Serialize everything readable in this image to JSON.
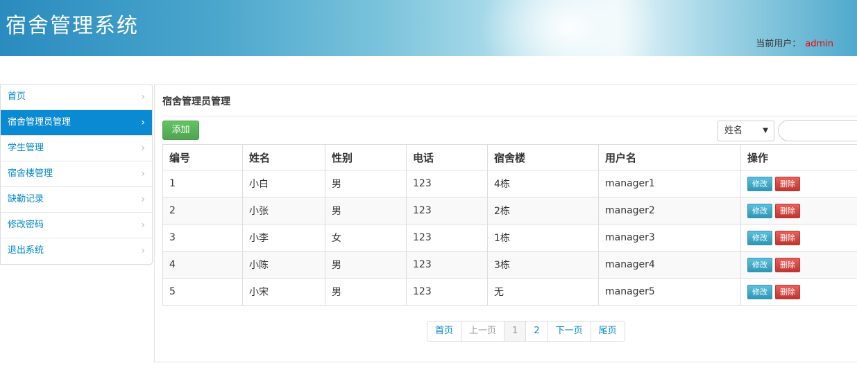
{
  "header": {
    "title": "宿舍管理系统",
    "user_label": "当前用户：",
    "user_name": "admin"
  },
  "sidebar": {
    "items": [
      {
        "label": "首页",
        "active": false
      },
      {
        "label": "宿舍管理员管理",
        "active": true
      },
      {
        "label": "学生管理",
        "active": false
      },
      {
        "label": "宿舍楼管理",
        "active": false
      },
      {
        "label": "缺勤记录",
        "active": false
      },
      {
        "label": "修改密码",
        "active": false
      },
      {
        "label": "退出系统",
        "active": false
      }
    ],
    "chevron": "›"
  },
  "main": {
    "title": "宿舍管理员管理",
    "add_label": "添加",
    "search": {
      "field_selected": "姓名",
      "input_value": ""
    },
    "table": {
      "headers": [
        "编号",
        "姓名",
        "性别",
        "电话",
        "宿舍楼",
        "用户名",
        "操作"
      ],
      "rows": [
        [
          "1",
          "小白",
          "男",
          "123",
          "4栋",
          "manager1"
        ],
        [
          "2",
          "小张",
          "男",
          "123",
          "2栋",
          "manager2"
        ],
        [
          "3",
          "小李",
          "女",
          "123",
          "1栋",
          "manager3"
        ],
        [
          "4",
          "小陈",
          "男",
          "123",
          "3栋",
          "manager4"
        ],
        [
          "5",
          "小宋",
          "男",
          "123",
          "无",
          "manager5"
        ]
      ],
      "edit_label": "修改",
      "delete_label": "删除"
    },
    "pagination": {
      "first": "首页",
      "prev": "上一页",
      "pages": [
        "1",
        "2"
      ],
      "current_page": "1",
      "next": "下一页",
      "last": "尾页"
    }
  },
  "colors": {
    "accent": "#0a8ad2",
    "link": "#0088cc",
    "add_button": "#5cb85c",
    "edit_button": "#5bc0de",
    "delete_button": "#d9534f",
    "user_name": "#ee0000"
  }
}
